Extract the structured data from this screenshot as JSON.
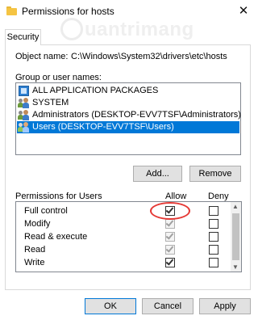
{
  "window": {
    "title": "Permissions for hosts",
    "close_glyph": "✕",
    "watermark": "uantrimang"
  },
  "tab": {
    "label": "Security"
  },
  "object": {
    "label": "Object name:",
    "value": "C:\\Windows\\System32\\drivers\\etc\\hosts"
  },
  "groups": {
    "label": "Group or user names:",
    "items": [
      {
        "label": "ALL APPLICATION PACKAGES",
        "icon": "app-packages-icon",
        "selected": false
      },
      {
        "label": "SYSTEM",
        "icon": "users-icon",
        "selected": false
      },
      {
        "label": "Administrators (DESKTOP-EVV7TSF\\Administrators)",
        "icon": "users-icon",
        "selected": false
      },
      {
        "label": "Users (DESKTOP-EVV7TSF\\Users)",
        "icon": "users-icon",
        "selected": true
      }
    ]
  },
  "buttons": {
    "add": "Add...",
    "remove": "Remove",
    "ok": "OK",
    "cancel": "Cancel",
    "apply": "Apply"
  },
  "permissions": {
    "label": "Permissions for Users",
    "allow_header": "Allow",
    "deny_header": "Deny",
    "rows": [
      {
        "label": "Full control",
        "allow": true,
        "allow_inherited": false,
        "deny": false
      },
      {
        "label": "Modify",
        "allow": true,
        "allow_inherited": true,
        "deny": false
      },
      {
        "label": "Read & execute",
        "allow": true,
        "allow_inherited": true,
        "deny": false
      },
      {
        "label": "Read",
        "allow": true,
        "allow_inherited": true,
        "deny": false
      },
      {
        "label": "Write",
        "allow": true,
        "allow_inherited": false,
        "deny": false
      }
    ]
  },
  "colors": {
    "selection": "#0078d7",
    "annotation": "#e53935"
  }
}
